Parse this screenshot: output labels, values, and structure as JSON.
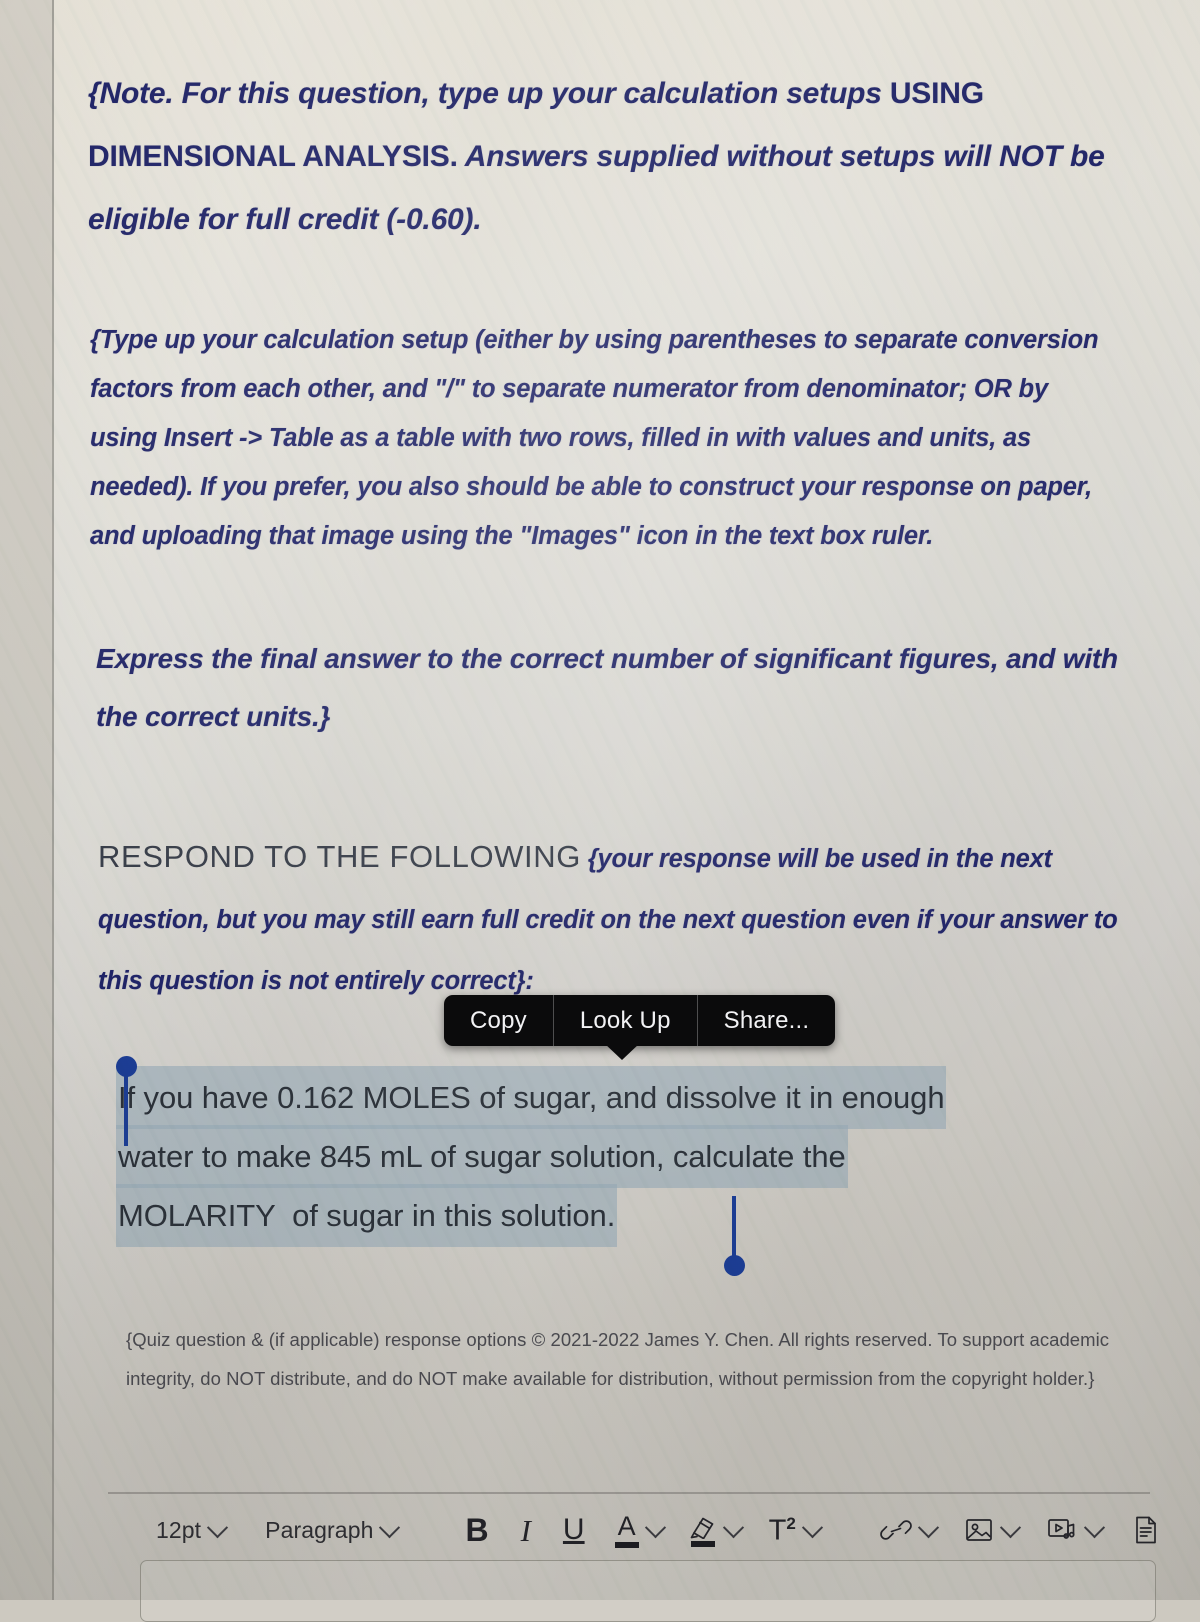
{
  "document": {
    "note_paragraph": {
      "italic_lead": "{Note. For this question, type up your calculation setups ",
      "emphasis_1": "USING DIMENSIONAL ANALYSIS.",
      "tail": " Answers supplied without setups will NOT be eligible for full credit (-0.60)."
    },
    "instructions_paragraph": "{Type up your calculation setup (either by using parentheses to separate conversion factors from each other, and \"/\" to separate numerator from denominator; OR by using Insert -> Table as a table with two rows, filled in with values and units, as needed).  If you prefer, you also should be able to construct your response on paper, and uploading that image using the \"Images\" icon in the text box ruler.",
    "express_paragraph": "Express the final answer to the correct number of significant figures, and with the correct units.}",
    "respond_heading": "RESPOND TO THE FOLLOWING",
    "respond_paragraph": "{your response will be used in the next question, but you may still earn full credit on the next question even if your answer to this question is not entirely correct}:",
    "question_lines": [
      "If you have 0.162 MOLES of sugar, and dissolve it in enough",
      "water to make 845 mL of sugar solution, calculate the",
      "MOLARITY  of sugar in this solution."
    ],
    "question_full_text": "If you have 0.162 MOLES of sugar, and dissolve it in enough water to make 845 mL of sugar solution, calculate the MOLARITY  of sugar in this solution.",
    "footnote": "{Quiz question & (if applicable) response options © 2021-2022 James Y. Chen. All rights reserved.  To support academic integrity, do NOT distribute, and do NOT make available for distribution, without permission from the copyright holder.}"
  },
  "selection_popup": {
    "items": [
      {
        "label": "Copy"
      },
      {
        "label": "Look Up"
      },
      {
        "label": "Share..."
      }
    ]
  },
  "toolbar": {
    "font_size": "12pt",
    "block_format": "Paragraph",
    "bold": "B",
    "italic": "I",
    "underline": "U",
    "text_color": "A",
    "superscript": "T",
    "superscript_exponent": "2",
    "icons": [
      "chevron-down-icon",
      "bold-icon",
      "italic-icon",
      "underline-icon",
      "text-color-icon",
      "highlighter-icon",
      "superscript-icon",
      "link-icon",
      "image-icon",
      "media-icon",
      "document-icon"
    ]
  },
  "colors": {
    "body_text": "#1d2166",
    "heading_text": "#343a46",
    "question_text": "#2b3139",
    "selection_highlight": "#96aab6",
    "selection_handle": "#1c3d95",
    "popup_background": "#0b0b0c",
    "popup_text": "#f2f2f4",
    "page_background": "#ddd9cf"
  }
}
